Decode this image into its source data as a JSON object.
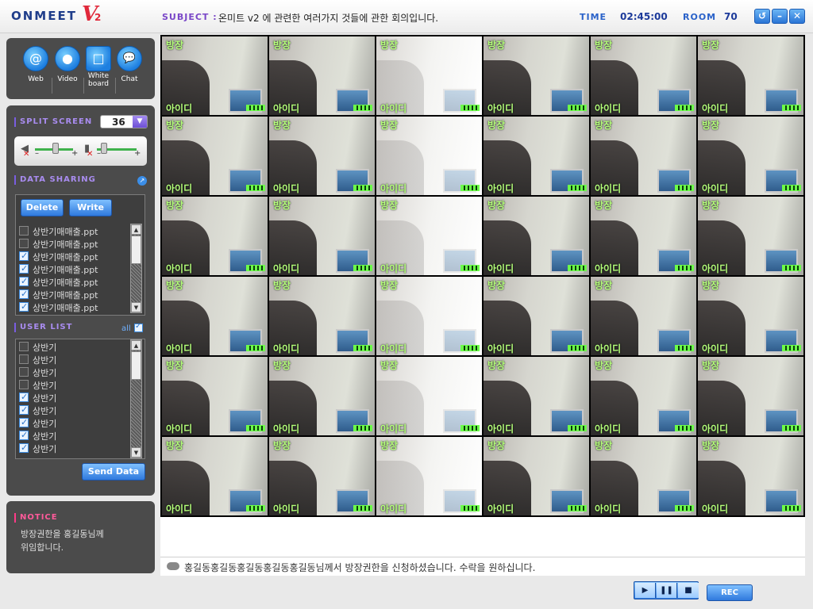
{
  "app": {
    "logo_text": "ONMEET",
    "logo_v": "V",
    "logo_version": "2"
  },
  "header": {
    "subject_label": "SUBJECT :",
    "subject_text": "온미트 v2 에 관련한 여러가지 것들에 관한 회의입니다.",
    "time_label": "TIME",
    "time_value": "02:45:00",
    "room_label": "ROOM",
    "room_value": "70",
    "window_buttons": [
      {
        "name": "restore-icon",
        "glyph": "↺"
      },
      {
        "name": "minimize-icon",
        "glyph": "–"
      },
      {
        "name": "close-icon",
        "glyph": "✕"
      }
    ]
  },
  "tools": [
    {
      "name": "web",
      "icon": "at-icon",
      "glyph": "@",
      "label": "Web"
    },
    {
      "name": "video",
      "icon": "video-camera-icon",
      "glyph": "●",
      "label": "Video"
    },
    {
      "name": "whiteboard",
      "icon": "whiteboard-icon",
      "glyph": "□",
      "label_line1": "White",
      "label_line2": "board"
    },
    {
      "name": "chat",
      "icon": "chat-bubble-icon",
      "glyph": "💬",
      "label": "Chat"
    }
  ],
  "split_screen": {
    "title": "SPLIT SCREEN",
    "value": "36"
  },
  "volume": {
    "speaker_level": 0.5,
    "mic_level": 0.1,
    "minus": "–",
    "plus": "+"
  },
  "data_sharing": {
    "title": "DATA SHARING",
    "delete_label": "Delete",
    "write_label": "Write",
    "files": [
      {
        "name": "상반기매매출.ppt",
        "checked": false
      },
      {
        "name": "상반기매매출.ppt",
        "checked": false
      },
      {
        "name": "상반기매매출.ppt",
        "checked": true
      },
      {
        "name": "상반기매매출.ppt",
        "checked": true
      },
      {
        "name": "상반기매매출.ppt",
        "checked": true
      },
      {
        "name": "상반기매매출.ppt",
        "checked": true
      },
      {
        "name": "상반기매매출.ppt",
        "checked": true
      }
    ]
  },
  "user_list": {
    "title": "USER LIST",
    "all_label": "all",
    "users": [
      {
        "name": "상반기",
        "checked": false
      },
      {
        "name": "상반기",
        "checked": false
      },
      {
        "name": "상반기",
        "checked": false
      },
      {
        "name": "상반기",
        "checked": false
      },
      {
        "name": "상반기",
        "checked": true
      },
      {
        "name": "상반기",
        "checked": true
      },
      {
        "name": "상반기",
        "checked": true
      },
      {
        "name": "상반기",
        "checked": true
      },
      {
        "name": "상반기",
        "checked": true
      }
    ],
    "send_label": "Send Data"
  },
  "notice": {
    "title": "NOTICE",
    "text_line1": "방장권한을 홍길동님께",
    "text_line2": "위임합니다."
  },
  "video_grid": {
    "host_label": "방장",
    "user_label": "아이디",
    "rows": 6,
    "cols": 6
  },
  "message_bar": {
    "text": "홍길동홍길동홍길동홍길동홍길동님께서 방장권한을 신청하셨습니다. 수락을 원하십니다."
  },
  "controls": {
    "play_glyph": "▶",
    "pause_glyph": "❚❚",
    "stop_glyph": "■",
    "rec_label": "REC"
  }
}
